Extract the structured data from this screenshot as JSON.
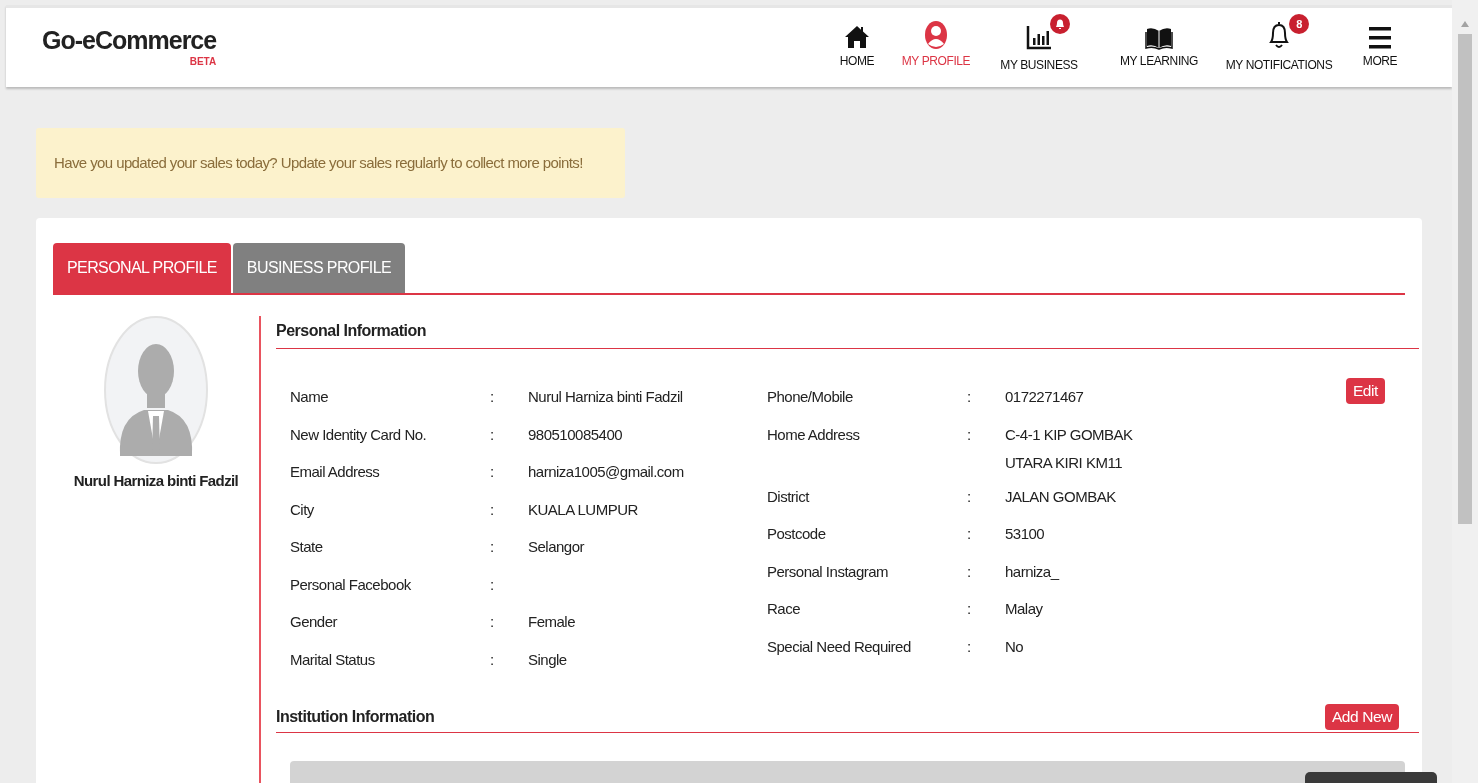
{
  "brand": {
    "name": "Go-eCommerce",
    "tag": "BETA"
  },
  "nav": [
    {
      "kind": "home",
      "label": "HOME",
      "selected": false
    },
    {
      "kind": "profile",
      "label": "MY PROFILE",
      "selected": true
    },
    {
      "kind": "business",
      "label": "MY BUSINESS",
      "selected": false,
      "alert_badge": true
    },
    {
      "kind": "learning",
      "label": "MY LEARNING",
      "selected": false
    },
    {
      "kind": "notifications",
      "label": "MY NOTIFICATIONS",
      "selected": false,
      "badge": "8"
    },
    {
      "kind": "more",
      "label": "MORE",
      "selected": false
    }
  ],
  "alert": "Have you updated your sales today? Update your sales regularly to collect more points!",
  "tabs": [
    {
      "label": "PERSONAL PROFILE",
      "selected": true
    },
    {
      "label": "BUSINESS PROFILE",
      "selected": false
    }
  ],
  "profile": {
    "name": "Nurul Harniza binti Fadzil"
  },
  "personal_information": {
    "title": "Personal Information",
    "edit_button": "Edit",
    "left_fields": [
      {
        "label": "Name",
        "separator": ":",
        "value": "Nurul Harniza binti Fadzil"
      },
      {
        "label": "New Identity Card No.",
        "separator": ":",
        "value": "980510085400"
      },
      {
        "label": "Email Address",
        "separator": ":",
        "value": "harniza1005@gmail.com"
      },
      {
        "label": "City",
        "separator": ":",
        "value": "KUALA LUMPUR"
      },
      {
        "label": "State",
        "separator": ":",
        "value": "Selangor"
      },
      {
        "label": "Personal Facebook",
        "separator": ":"
      },
      {
        "label": "Gender",
        "separator": ":",
        "value": "Female"
      },
      {
        "label": "Marital Status",
        "separator": ":",
        "value": "Single"
      }
    ],
    "right_fields": [
      {
        "label": "Phone/Mobile",
        "separator": ":",
        "value": "0172271467"
      },
      {
        "label": "Home Address",
        "separator": ":",
        "value_lines": [
          "C-4-1 KIP GOMBAK",
          "UTARA KIRI KM11"
        ]
      },
      {
        "label": "District",
        "separator": ":",
        "value": "JALAN GOMBAK"
      },
      {
        "label": "Postcode",
        "separator": ":",
        "value": "53100"
      },
      {
        "label": "Personal Instagram",
        "separator": ":",
        "value": "harniza_"
      },
      {
        "label": "Race",
        "separator": ":",
        "value": "Malay"
      },
      {
        "label": "Special Need Required",
        "separator": ":",
        "value": "No"
      }
    ]
  },
  "institution_information": {
    "title": "Institution Information",
    "add_button": "Add New"
  }
}
